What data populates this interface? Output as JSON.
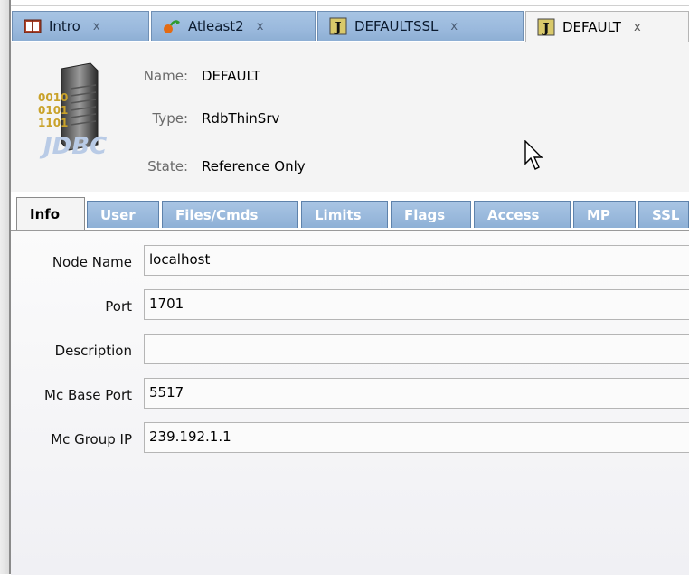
{
  "doc_tabs": [
    {
      "label": "Intro",
      "close": "x",
      "icon": "book-icon"
    },
    {
      "label": "Atleast2",
      "close": "x",
      "icon": "sync-icon"
    },
    {
      "label": "DEFAULTSSL",
      "close": "x",
      "icon": "j-icon"
    },
    {
      "label": "DEFAULT",
      "close": "x",
      "icon": "j-icon"
    }
  ],
  "header": {
    "logo_text": "JDBC",
    "name_label": "Name:",
    "name_value": "DEFAULT",
    "type_label": "Type:",
    "type_value": "RdbThinSrv",
    "state_label": "State:",
    "state_value": "Reference Only"
  },
  "sub_tabs": [
    "Info",
    "User",
    "Files/Cmds",
    "Limits",
    "Flags",
    "Access",
    "MP",
    "SSL"
  ],
  "fields": [
    {
      "label": "Node Name",
      "value": "localhost"
    },
    {
      "label": "Port",
      "value": "1701"
    },
    {
      "label": "Description",
      "value": ""
    },
    {
      "label": "Mc Base Port",
      "value": "5517"
    },
    {
      "label": "Mc Group IP",
      "value": "239.192.1.1"
    }
  ],
  "colors": {
    "tab_blue": "#9ab9dd",
    "accent": "#5e82ab"
  }
}
